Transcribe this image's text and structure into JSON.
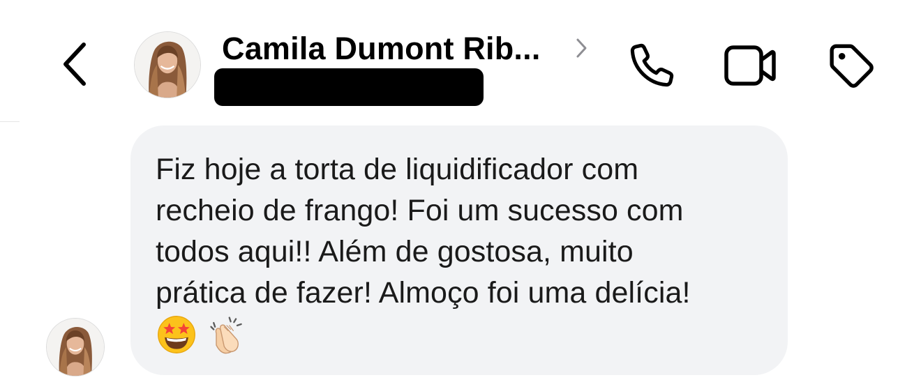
{
  "header": {
    "back_icon": "chevron-left-icon",
    "contact_name": "Camila Dumont Rib...",
    "name_chevron_icon": "chevron-right-icon",
    "actions": [
      {
        "name": "call",
        "icon": "phone-icon"
      },
      {
        "name": "video-call",
        "icon": "video-camera-icon"
      },
      {
        "name": "tag",
        "icon": "tag-icon"
      }
    ]
  },
  "message": {
    "text": "Fiz hoje a torta de liquidificador com\nrecheio de frango! Foi um sucesso com\ntodos aqui!! Além de gostosa, muito\nprática de fazer! Almoço foi uma delícia!",
    "emojis": [
      "star-struck-emoji",
      "clapping-hands-emoji"
    ]
  },
  "colors": {
    "bubble_background": "#f2f3f5",
    "text": "#1a1a1a",
    "icon": "#000000",
    "chevron_muted": "#8e8e93"
  }
}
